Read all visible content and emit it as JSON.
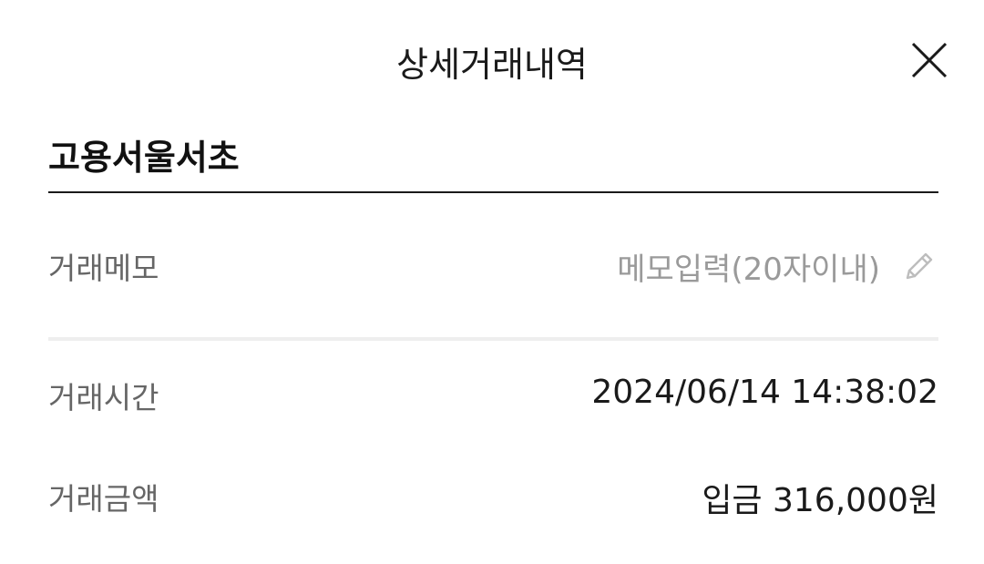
{
  "header": {
    "title": "상세거래내역",
    "close_icon": "close-icon"
  },
  "merchant": {
    "name": "고용서울서초"
  },
  "memo": {
    "label": "거래메모",
    "placeholder": "메모입력(20자이내)",
    "icon": "pencil-icon"
  },
  "details": {
    "time_label": "거래시간",
    "time_value": "2024/06/14 14:38:02",
    "amount_label": "거래금액",
    "amount_value": "입금 316,000원"
  },
  "colors": {
    "text_primary": "#1a1a1a",
    "text_label": "#666666",
    "placeholder": "#9a9a9a",
    "divider": "#eeeeee"
  }
}
